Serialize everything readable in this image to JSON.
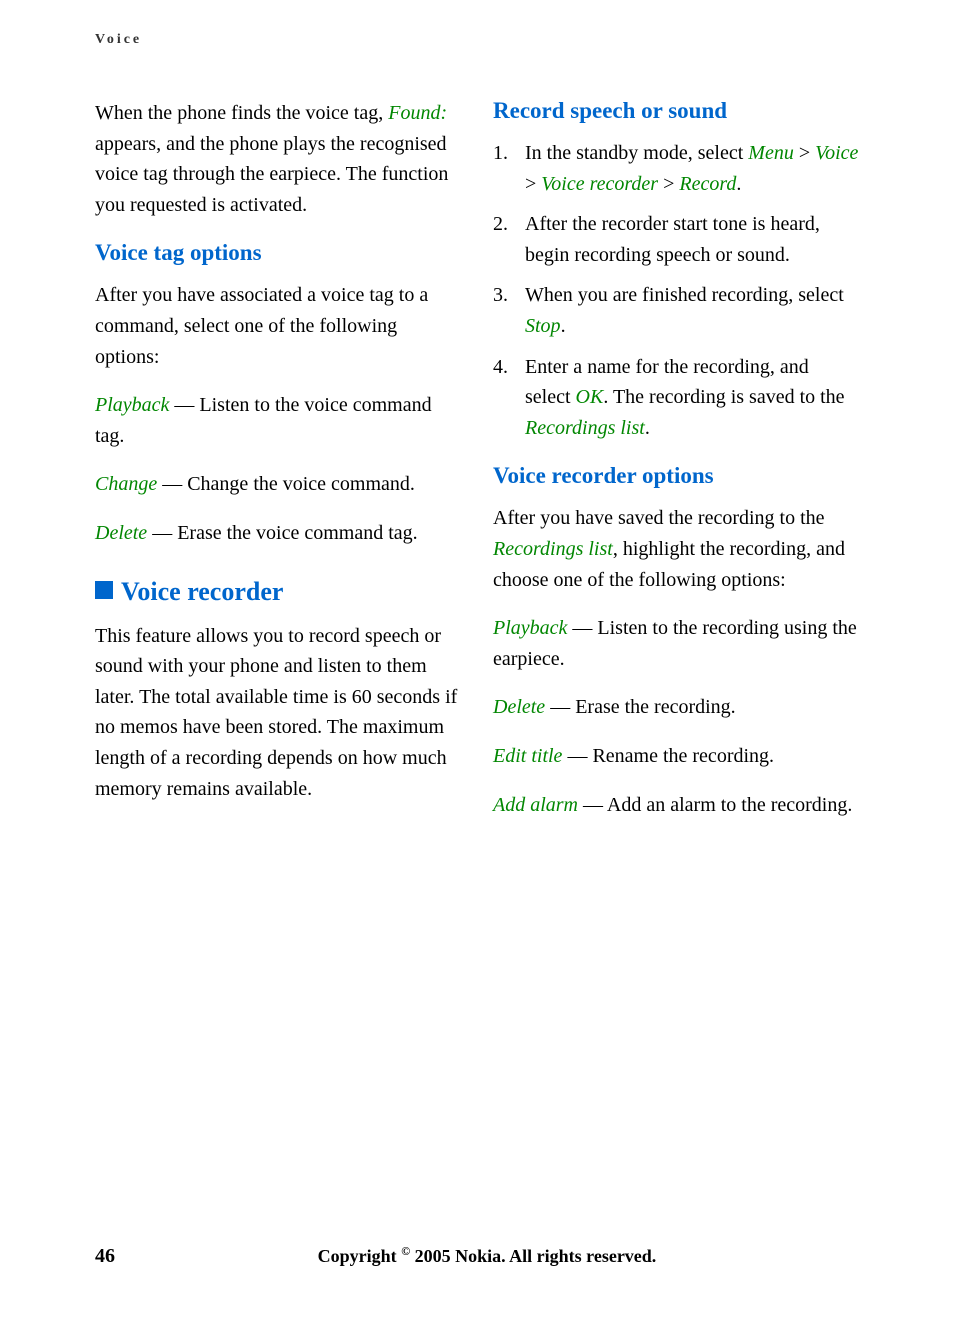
{
  "running_header": "Voice",
  "col1": {
    "intro_p1_a": "When the phone finds the voice tag, ",
    "intro_p1_found": "Found:",
    "intro_p1_b": " appears, and the phone plays the recognised voice tag through the earpiece. The function you requested is activated.",
    "h2_voice_tag": "Voice tag options",
    "vto_intro": "After you have associated a voice tag to a command, select one of the following options:",
    "vto_playback_t": "Playback",
    "vto_playback_d": " — Listen to the voice command tag.",
    "vto_change_t": "Change",
    "vto_change_d": " — Change the voice command.",
    "vto_delete_t": "Delete",
    "vto_delete_d": " — Erase the voice command tag.",
    "h1_voice_rec": "Voice recorder",
    "vr_intro": "This feature allows you to record speech or sound with your phone and listen to them later. The total available time is 60 seconds if no memos have been stored. The maximum length of a recording depends on how much memory remains available."
  },
  "col2": {
    "h2_record": "Record speech or sound",
    "step1_a": "In the standby mode, select ",
    "step1_menu": "Menu",
    "step1_voice": "Voice",
    "step1_vr": "Voice recorder",
    "step1_record": "Record",
    "step2": "After the recorder start tone is heard, begin recording speech or sound.",
    "step3_a": "When you are finished recording, select ",
    "step3_stop": "Stop",
    "step4_a": "Enter a name for the recording, and select ",
    "step4_ok": "OK",
    "step4_b": ". The recording is saved to the ",
    "step4_rl": "Recordings list",
    "h2_vro": "Voice recorder options",
    "vro_intro_a": "After you have saved the recording to the ",
    "vro_intro_rl": "Recordings list",
    "vro_intro_b": ", highlight the recording, and choose one of the following options:",
    "vro_playback_t": "Playback",
    "vro_playback_d": " — Listen to the recording using the earpiece.",
    "vro_delete_t": "Delete",
    "vro_delete_d": " — Erase the recording.",
    "vro_edit_t": "Edit title",
    "vro_edit_d": " — Rename the recording.",
    "vro_alarm_t": "Add alarm",
    "vro_alarm_d": " — Add an alarm to the recording."
  },
  "footer": {
    "page_num": "46",
    "copyright_a": "Copyright ",
    "copyright_sym": "©",
    "copyright_b": " 2005 Nokia. All rights reserved."
  }
}
